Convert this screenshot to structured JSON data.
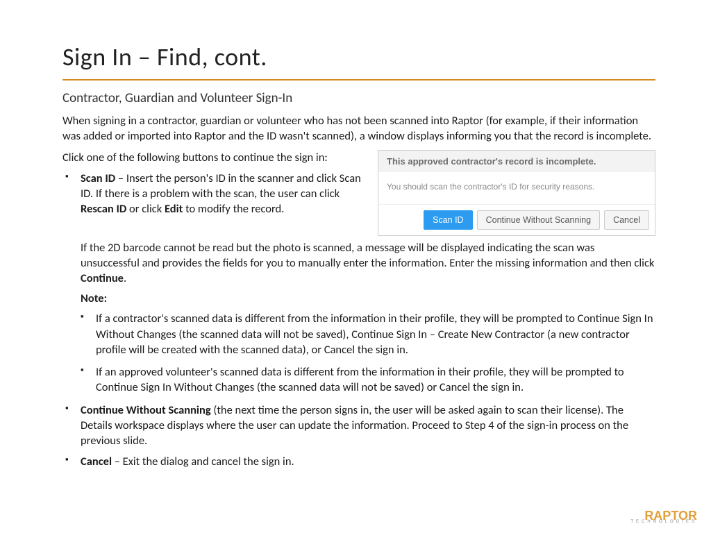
{
  "title": "Sign In – Find, cont.",
  "subtitle": "Contractor, Guardian and Volunteer Sign-In",
  "intro": "When signing in a contractor, guardian or volunteer who has not been scanned into Raptor (for example, if their information was added or imported into Raptor and the ID wasn't scanned), a window displays informing you that the record is incomplete.",
  "lead_in": "Click one of the following buttons to continue the sign in:",
  "bullets": {
    "scan_id_label": "Scan ID",
    "scan_id_text_1": " – Insert the person's ID in the scanner and click Scan ID. If there is a problem with the scan, the user can click ",
    "scan_id_bold_1": "Rescan ID",
    "scan_id_text_2": " or click ",
    "scan_id_bold_2": "Edit",
    "scan_id_text_3": " to modify the record.",
    "scan_barcode_para_a": "If the 2D barcode cannot be read but the photo is scanned, a message will be displayed indicating the scan was unsuccessful and provides the fields for you to manually enter the information. Enter the missing information and then click ",
    "scan_barcode_bold": "Continue",
    "scan_barcode_para_b": ".",
    "note_label": "Note:",
    "note_items": [
      "If a contractor's scanned data is different from the information in their profile, they will be prompted to Continue Sign In Without Changes (the scanned data will not be saved), Continue Sign In – Create New Contractor (a new contractor profile will be created with the scanned data), or Cancel the sign in.",
      "If an approved volunteer's scanned data is different from the information in their profile, they will be prompted to Continue Sign In Without Changes (the scanned data will not be saved) or Cancel the sign in."
    ],
    "cws_label": "Continue Without Scanning",
    "cws_text": " (the next time the person signs in, the user will be asked again to scan their license). The Details workspace displays where the user can update the information. Proceed to Step 4 of the sign-in process on the previous slide.",
    "cancel_label": "Cancel",
    "cancel_text": " – Exit the dialog and cancel the sign in."
  },
  "dialog": {
    "header": "This approved contractor's record is incomplete.",
    "body": "You should scan the contractor's ID for security reasons.",
    "buttons": {
      "scan": "Scan ID",
      "continue": "Continue Without Scanning",
      "cancel": "Cancel"
    }
  },
  "logo": {
    "main": "RAPTOR",
    "sub": "TECHNOLOGIES"
  }
}
